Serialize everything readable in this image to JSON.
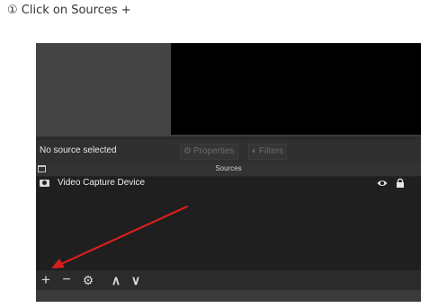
{
  "caption": "① Click on Sources +",
  "obs": {
    "no_source_text": "No source selected",
    "properties_label": "Properties",
    "filters_label": "Filters",
    "sources_title": "Sources",
    "sources": [
      {
        "name": "Video Capture Device",
        "icon": "camera-icon",
        "visible": true,
        "locked": true
      }
    ],
    "toolbar": {
      "add": "+",
      "remove": "−",
      "settings": "⚙",
      "up": "∧",
      "down": "∨"
    },
    "colors": {
      "window_bg": "#2b2b2b",
      "list_bg": "#1f1f1f",
      "canvas": "#000000",
      "annotation_arrow": "#d81e1e"
    }
  }
}
